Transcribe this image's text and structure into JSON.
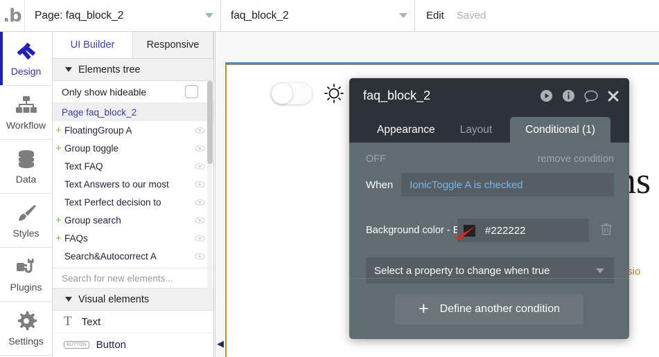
{
  "topbar": {
    "logo": "bubble-logo",
    "page_selector_value": "Page: faq_block_2",
    "element_selector_value": "faq_block_2",
    "edit_label": "Edit",
    "saved_label": "Saved"
  },
  "rail": {
    "items": [
      {
        "label": "Design",
        "icon": "design-icon",
        "active": true
      },
      {
        "label": "Workflow",
        "icon": "workflow-icon",
        "active": false
      },
      {
        "label": "Data",
        "icon": "data-icon",
        "active": false
      },
      {
        "label": "Styles",
        "icon": "styles-icon",
        "active": false
      },
      {
        "label": "Plugins",
        "icon": "plugins-icon",
        "active": false
      },
      {
        "label": "Settings",
        "icon": "settings-icon",
        "active": false
      }
    ]
  },
  "panel": {
    "tabs": [
      {
        "label": "UI Builder",
        "active": true
      },
      {
        "label": "Responsive",
        "active": false
      }
    ],
    "elements_tree_header": "Elements tree",
    "only_show_hideable_label": "Only show hideable",
    "tree": [
      {
        "name": "Page faq_block_2",
        "selected": true,
        "expandable": false,
        "eye": false
      },
      {
        "name": "FloatingGroup A",
        "selected": false,
        "expandable": true,
        "eye": true
      },
      {
        "name": "Group toggle",
        "selected": false,
        "expandable": true,
        "eye": true
      },
      {
        "name": "Text FAQ",
        "selected": false,
        "expandable": false,
        "eye": true
      },
      {
        "name": "Text Answers to our most",
        "selected": false,
        "expandable": false,
        "eye": true
      },
      {
        "name": "Text Perfect decision to",
        "selected": false,
        "expandable": false,
        "eye": true
      },
      {
        "name": "Group search",
        "selected": false,
        "expandable": true,
        "eye": true
      },
      {
        "name": "FAQs",
        "selected": false,
        "expandable": true,
        "eye": true
      },
      {
        "name": "Search&Autocorrect A",
        "selected": false,
        "expandable": false,
        "eye": true
      }
    ],
    "search_placeholder": "Search for new elements...",
    "visual_elements_header": "Visual elements",
    "visual_elements": [
      {
        "label": "Text",
        "icon": "text-T-icon"
      },
      {
        "label": "Button",
        "icon": "button-icon"
      }
    ]
  },
  "canvas": {
    "toggle_state": "off",
    "toggle_icon": "toggle-switch",
    "sun_icon": "sun-icon",
    "cut_heading_text": "ns",
    "cut_subtext": "sio",
    "collapse_arrow": "◀"
  },
  "dialog": {
    "title": "faq_block_2",
    "icons": [
      "play-icon",
      "info-icon",
      "comment-icon",
      "close-icon"
    ],
    "tabs": [
      {
        "label": "Appearance",
        "active": false
      },
      {
        "label": "Layout",
        "active": false
      },
      {
        "label": "Conditional (1)",
        "active": true
      }
    ],
    "condition": {
      "state_label": "OFF",
      "remove_label": "remove condition",
      "when_label": "When",
      "when_expression": "IonicToggle A is checked",
      "property_label": "Background color - E",
      "color_hex": "#222222",
      "color_value": "#222222",
      "delete_icon": "trash-icon"
    },
    "property_select_placeholder": "Select a property to change when true",
    "define_another_label": "Define another condition",
    "define_another_icon": "plus-icon"
  }
}
